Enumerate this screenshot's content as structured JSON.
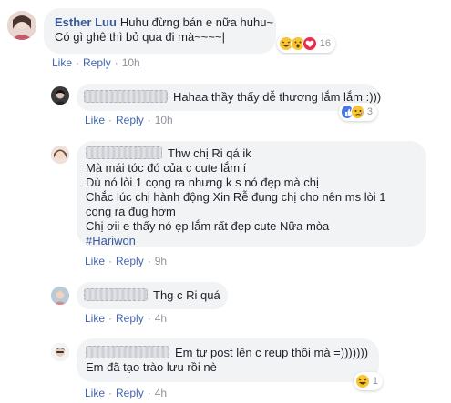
{
  "comments": [
    {
      "author": "Esther Luu",
      "lines": [
        "Huhu đừng bán e nữa huhu~",
        "Có gì ghê thì bỏ qua đi mà~~~~|"
      ],
      "reaction_count": "16",
      "reactions": [
        "haha-icon",
        "wow-icon",
        "love-icon"
      ],
      "like": "Like",
      "reply": "Reply",
      "time": "10h"
    },
    {
      "author_hidden": true,
      "lines": [
        "Hahaa thầy thấy dễ thương lắm lắm :)))"
      ],
      "reaction_count": "3",
      "reactions": [
        "like-icon",
        "sad-icon"
      ],
      "like": "Like",
      "reply": "Reply",
      "time": "10h"
    },
    {
      "author_hidden": true,
      "lines": [
        "Thw chị Ri qá ik",
        "Mà mái tóc đó của c cute lắm í",
        "Dù nó lòi 1 cọng ra nhưng k s nó đẹp mà chị",
        "Chắc lúc chị hành động Xin Rễ đụng chị cho nên ms lòi 1",
        "cọng ra đug hơm",
        "Chị ơii e thấy nó ẹp lắm rất đẹp cute Nữa mòa"
      ],
      "hashtag": "#Hariwon",
      "like": "Like",
      "reply": "Reply",
      "time": "9h"
    },
    {
      "author_hidden": true,
      "lines": [
        "Thg c Ri quá"
      ],
      "like": "Like",
      "reply": "Reply",
      "time": "4h"
    },
    {
      "author_hidden": true,
      "lines": [
        "Em tự post lên c reup thôi mà =)))))))",
        "Em đã tạo trào lưu rồi nè"
      ],
      "reaction_count": "1",
      "reactions": [
        "haha-icon"
      ],
      "like": "Like",
      "reply": "Reply",
      "time": "4h"
    }
  ],
  "colors": {
    "bubble": "#f2f3f5",
    "author": "#385898",
    "link": "#4267b2",
    "meta": "#90949c",
    "text": "#1d2129"
  }
}
